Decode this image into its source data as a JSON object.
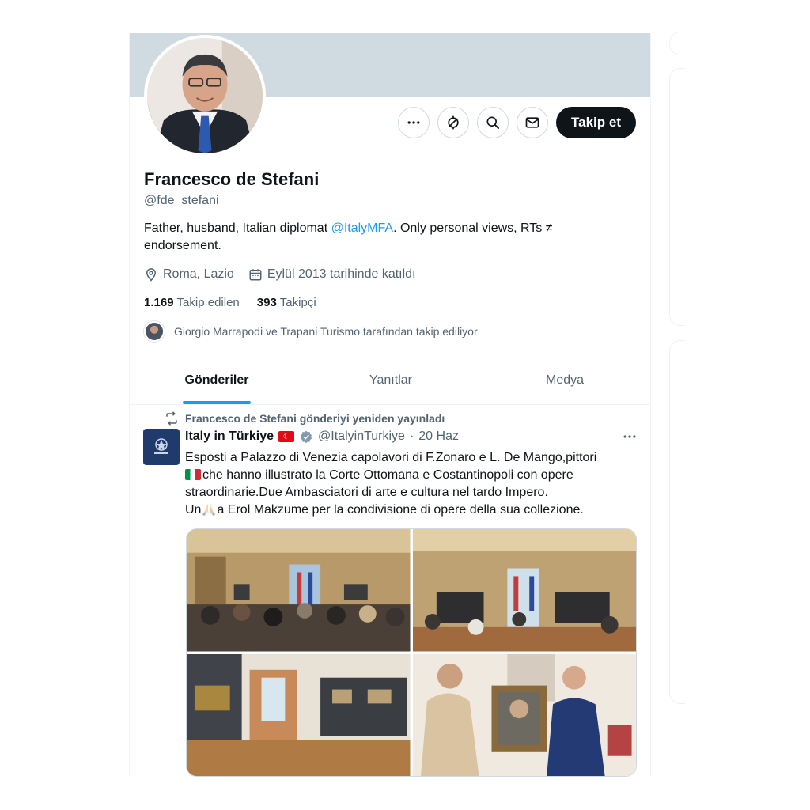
{
  "profile": {
    "name": "Francesco de Stefani",
    "handle": "@fde_stefani",
    "bio_before": "Father, husband, Italian diplomat ",
    "bio_mention": "@ItalyMFA",
    "bio_after": ". Only personal views, RTs ≠ endorsement.",
    "location": "Roma, Lazio",
    "joined": "Eylül 2013 tarihinde katıldı",
    "following_count": "1.169",
    "following_label": "Takip edilen",
    "followers_count": "393",
    "followers_label": "Takipçi",
    "followed_by": "Giorgio Marrapodi ve Trapani Turismo tarafından takip ediliyor"
  },
  "actions": {
    "follow_label": "Takip et",
    "icons": [
      "more-icon",
      "notifications-off-icon",
      "search-icon",
      "message-icon"
    ]
  },
  "tabs": [
    {
      "label": "Gönderiler",
      "active": true
    },
    {
      "label": "Yanıtlar",
      "active": false
    },
    {
      "label": "Medya",
      "active": false
    }
  ],
  "post": {
    "repost_notice": "Francesco de Stefani gönderiyi yeniden yayınladı",
    "author_name": "Italy in Türkiye",
    "author_handle": "@ItalyinTurkiye",
    "separator": "·",
    "date": "20 Haz",
    "text_line1": "Esposti a Palazzo di Venezia capolavori di F.Zonaro e L. De Mango,pittori",
    "text_line2": "che hanno illustrato la Corte Ottomana e Costantinopoli con opere",
    "text_line3": "straordinarie.Due Ambasciatori di arte e cultura nel tardo Impero.",
    "text_line4_a": "Un",
    "text_line4_b": "a Erol Makzume per la condivisione di opere della sua collezione.",
    "media_count": 4
  },
  "colors": {
    "accent": "#1d9bf0",
    "banner": "#cfdbe0",
    "text": "#0f1419",
    "secondary": "#536471",
    "follow_bg": "#0f1419"
  }
}
